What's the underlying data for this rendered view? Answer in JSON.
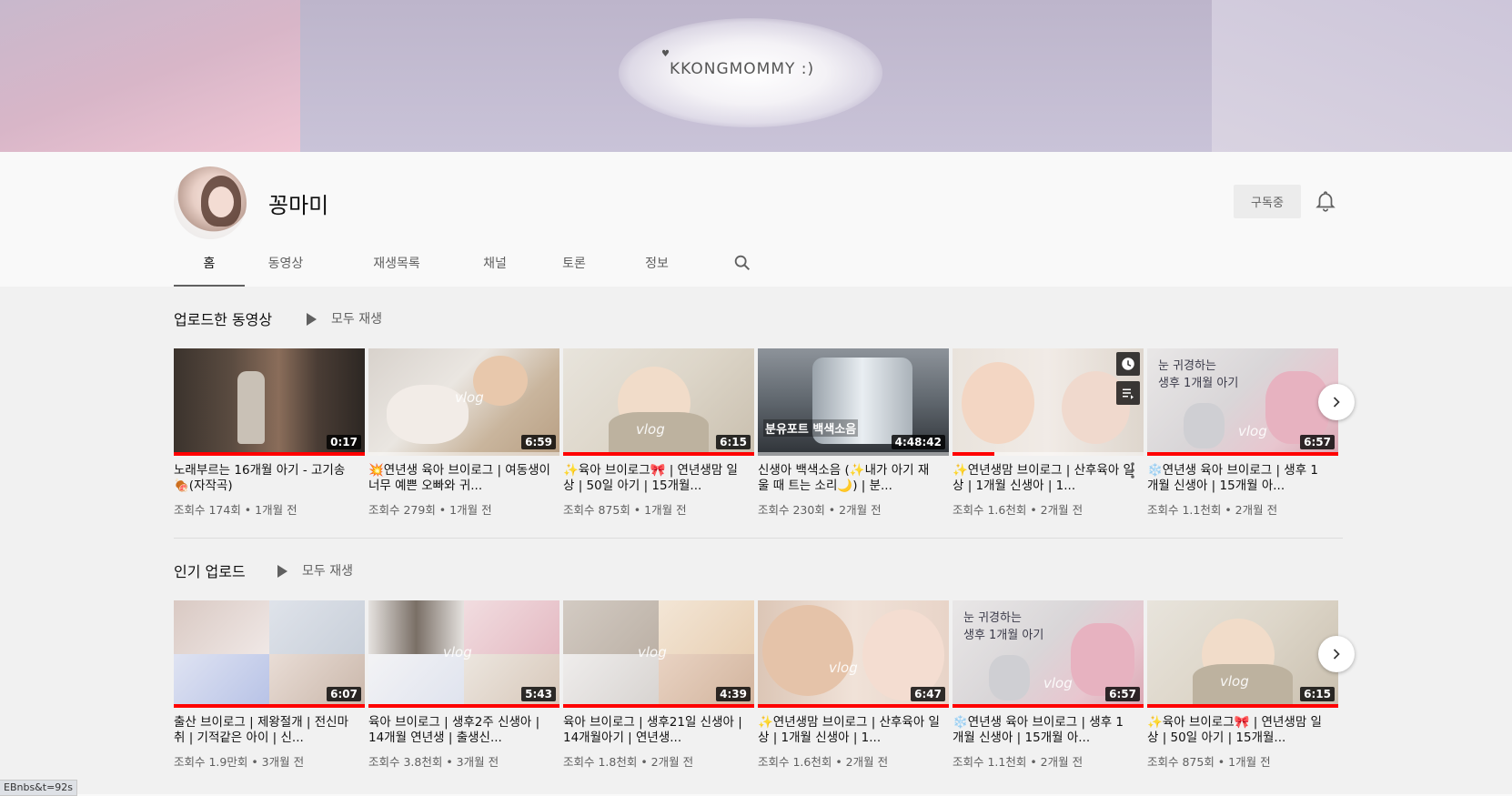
{
  "banner": {
    "logo_text": "KKONGMOMMY :)"
  },
  "channel": {
    "name": "꽁마미",
    "subscribe_label": "구독중"
  },
  "tabs": [
    {
      "label": "홈",
      "active": true
    },
    {
      "label": "동영상"
    },
    {
      "label": "재생목록"
    },
    {
      "label": "채널"
    },
    {
      "label": "토론"
    },
    {
      "label": "정보"
    }
  ],
  "sections": [
    {
      "title": "업로드한 동영상",
      "play_all": "모두 재생",
      "videos": [
        {
          "title": "노래부르는 16개월 아기 - 고기송🍖(자작곡)",
          "meta": "조회수 174회 • 1개월 전",
          "duration": "0:17",
          "progress": 1.0
        },
        {
          "title": "💥연년생 육아 브이로그 | 여동생이 너무 예쁜 오빠와 귀...",
          "meta": "조회수 279회 • 1개월 전",
          "duration": "6:59",
          "progress": 0.0
        },
        {
          "title": "✨육아 브이로그🎀 | 연년생맘 일상 | 50일 아기 | 15개월...",
          "meta": "조회수 875회 • 1개월 전",
          "duration": "6:15",
          "progress": 1.0
        },
        {
          "title": "신생아 백색소음 (✨내가 아기 재울 때 트는 소리🌙) | 분...",
          "meta": "조회수 230회 • 2개월 전",
          "duration": "4:48:42",
          "progress": 0.0
        },
        {
          "title": "✨연년생맘 브이로그 | 산후육아 일상 | 1개월 신생아 | 1...",
          "meta": "조회수 1.6천회 • 2개월 전",
          "duration": "",
          "progress": 0.22
        },
        {
          "title": "❄️연년생 육아 브이로그 | 생후 1개월 신생아 | 15개월 아...",
          "meta": "조회수 1.1천회 • 2개월 전",
          "duration": "6:57",
          "progress": 1.0
        }
      ]
    },
    {
      "title": "인기 업로드",
      "play_all": "모두 재생",
      "videos": [
        {
          "title": "출산 브이로그 | 제왕절개 | 전신마취 | 기적같은 아이 | 신...",
          "meta": "조회수 1.9만회 • 3개월 전",
          "duration": "6:07",
          "progress": 1.0
        },
        {
          "title": "육아 브이로그 | 생후2주 신생아 | 14개월 연년생 | 출생신...",
          "meta": "조회수 3.8천회 • 3개월 전",
          "duration": "5:43",
          "progress": 1.0
        },
        {
          "title": "육아 브이로그 | 생후21일 신생아 | 14개월아기 | 연년생...",
          "meta": "조회수 1.8천회 • 2개월 전",
          "duration": "4:39",
          "progress": 1.0
        },
        {
          "title": "✨연년생맘 브이로그 | 산후육아 일상 | 1개월 신생아 | 1...",
          "meta": "조회수 1.6천회 • 2개월 전",
          "duration": "6:47",
          "progress": 1.0
        },
        {
          "title": "❄️연년생 육아 브이로그 | 생후 1개월 신생아 | 15개월 아...",
          "meta": "조회수 1.1천회 • 2개월 전",
          "duration": "6:57",
          "progress": 1.0
        },
        {
          "title": "✨육아 브이로그🎀 | 연년생맘 일상 | 50일 아기 | 15개월...",
          "meta": "조회수 875회 • 1개월 전",
          "duration": "6:15",
          "progress": 1.0
        }
      ]
    }
  ],
  "statusbar": {
    "text": "EBnbs&t=92s"
  },
  "colors": {
    "progress": "#ff0000",
    "background": "#f1f1f1"
  }
}
